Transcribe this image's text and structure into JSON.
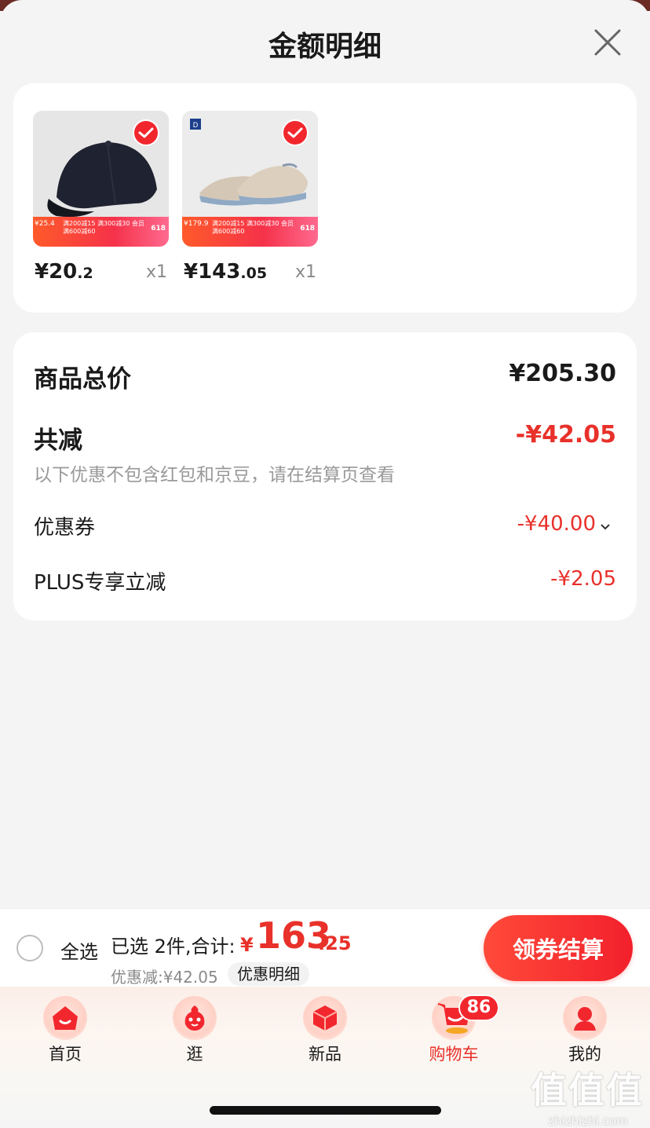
{
  "sheet": {
    "title": "金额明细"
  },
  "products": [
    {
      "price_int": "¥20",
      "price_dec": ".2",
      "qty": "x1",
      "promo_tag": "¥25.4",
      "promo_text": "满200减15 满300减30 会员满600减60",
      "badge": "618"
    },
    {
      "price_int": "¥143",
      "price_dec": ".05",
      "qty": "x1",
      "promo_tag": "¥179.9",
      "promo_text": "满200减15 满300减30 会员满600减60",
      "badge": "618"
    }
  ],
  "summary": {
    "total_label": "商品总价",
    "total_value": "¥205.30",
    "reduce_label": "共减",
    "reduce_value": "-¥42.05",
    "note": "以下优惠不包含红包和京豆，请在结算页查看",
    "coupon_label": "优惠券",
    "coupon_value": "-¥40.00",
    "plus_label": "PLUS专享立减",
    "plus_value": "-¥2.05"
  },
  "bottom_bar": {
    "select_all": "全选",
    "selected_text": "已选 2件,合计:",
    "total_yen": "¥",
    "total_int": "163",
    "total_dec": ".25",
    "discount_text": "优惠减:¥42.05",
    "detail_button": "优惠明细",
    "checkout_button": "领券结算"
  },
  "tabs": [
    {
      "label": "首页",
      "icon": "home-icon"
    },
    {
      "label": "逛",
      "icon": "browse-icon"
    },
    {
      "label": "新品",
      "icon": "new-products-icon"
    },
    {
      "label": "购物车",
      "icon": "cart-icon",
      "active": true,
      "badge": "86"
    },
    {
      "label": "我的",
      "icon": "profile-icon"
    }
  ],
  "watermark": {
    "glyphs": "值值值",
    "url": "zhizhizhi.com"
  },
  "colors": {
    "accent_red": "#e8312a",
    "button_red": "#f2272e",
    "background": "#f4f4f4"
  }
}
